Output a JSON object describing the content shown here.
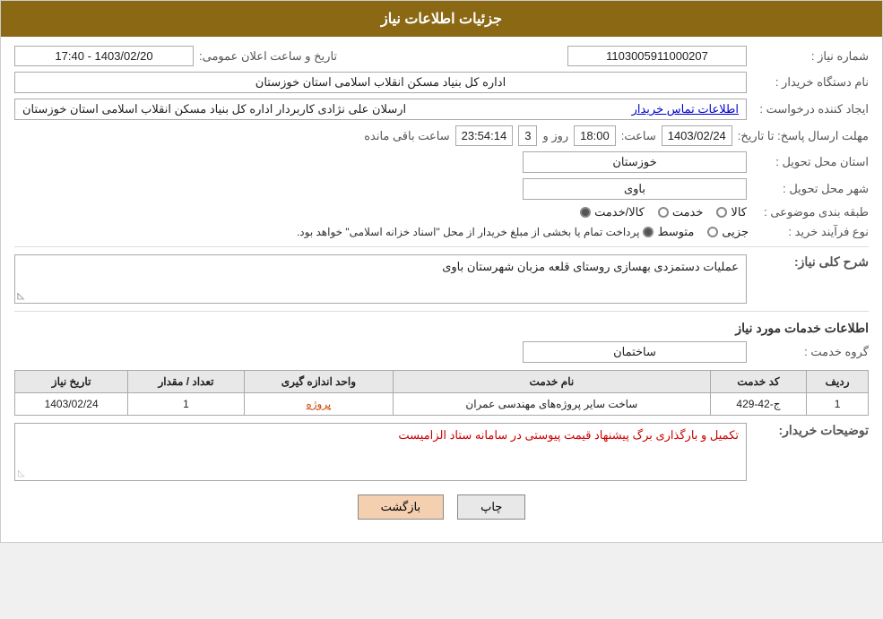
{
  "header": {
    "title": "جزئیات اطلاعات نیاز"
  },
  "fields": {
    "niyaz_number_label": "شماره نیاز :",
    "niyaz_number_value": "1103005911000207",
    "date_label": "تاریخ و ساعت اعلان عمومی:",
    "date_value": "1403/02/20 - 17:40",
    "buyer_org_label": "نام دستگاه خریدار :",
    "buyer_org_value": "اداره کل بنیاد مسکن انقلاب اسلامی استان خوزستان",
    "creator_label": "ایجاد کننده درخواست :",
    "creator_value": "ارسلان علی نژادی کاربردار اداره کل بنیاد مسکن انقلاب اسلامی استان خوزستان",
    "creator_link": "اطلاعات تماس خریدار",
    "deadline_label": "مهلت ارسال پاسخ: تا تاریخ:",
    "deadline_date": "1403/02/24",
    "deadline_time_label": "ساعت:",
    "deadline_time": "18:00",
    "remaining_days_label": "روز و",
    "remaining_days": "3",
    "remaining_time_label": "ساعت باقی مانده",
    "remaining_time": "23:54:14",
    "province_label": "استان محل تحویل :",
    "province_value": "خوزستان",
    "city_label": "شهر محل تحویل :",
    "city_value": "باوی",
    "category_label": "طبقه بندی موضوعی :",
    "category_kala": "کالا",
    "category_khadamat": "خدمت",
    "category_kala_khadamat": "کالا/خدمت",
    "process_label": "نوع فرآیند خرید :",
    "process_jozii": "جزیی",
    "process_motavaset": "متوسط",
    "process_note": "پرداخت تمام یا بخشی از مبلغ خریدار از محل \"اسناد خزانه اسلامی\" خواهد بود.",
    "description_label": "شرح کلی نیاز:",
    "description_value": "عملیات دستمزدی بهسازی روستای قلعه مزبان شهرستان باوی",
    "services_section_title": "اطلاعات خدمات مورد نیاز",
    "service_group_label": "گروه خدمت :",
    "service_group_value": "ساختمان",
    "table": {
      "col_radif": "ردیف",
      "col_code": "کد خدمت",
      "col_name": "نام خدمت",
      "col_unit": "واحد اندازه گیری",
      "col_count": "تعداد / مقدار",
      "col_date": "تاریخ نیاز",
      "rows": [
        {
          "radif": "1",
          "code": "ج-42-429",
          "name": "ساخت سایر پروژه‌های مهندسی عمران",
          "unit": "پروژه",
          "count": "1",
          "date": "1403/02/24"
        }
      ]
    },
    "buyer_desc_label": "توضیحات خریدار:",
    "buyer_desc_value": "تکمیل و بارگذاری برگ پیشنهاد قیمت پیوستی در سامانه ستاد الزامیست"
  },
  "buttons": {
    "print": "چاپ",
    "back": "بازگشت"
  }
}
